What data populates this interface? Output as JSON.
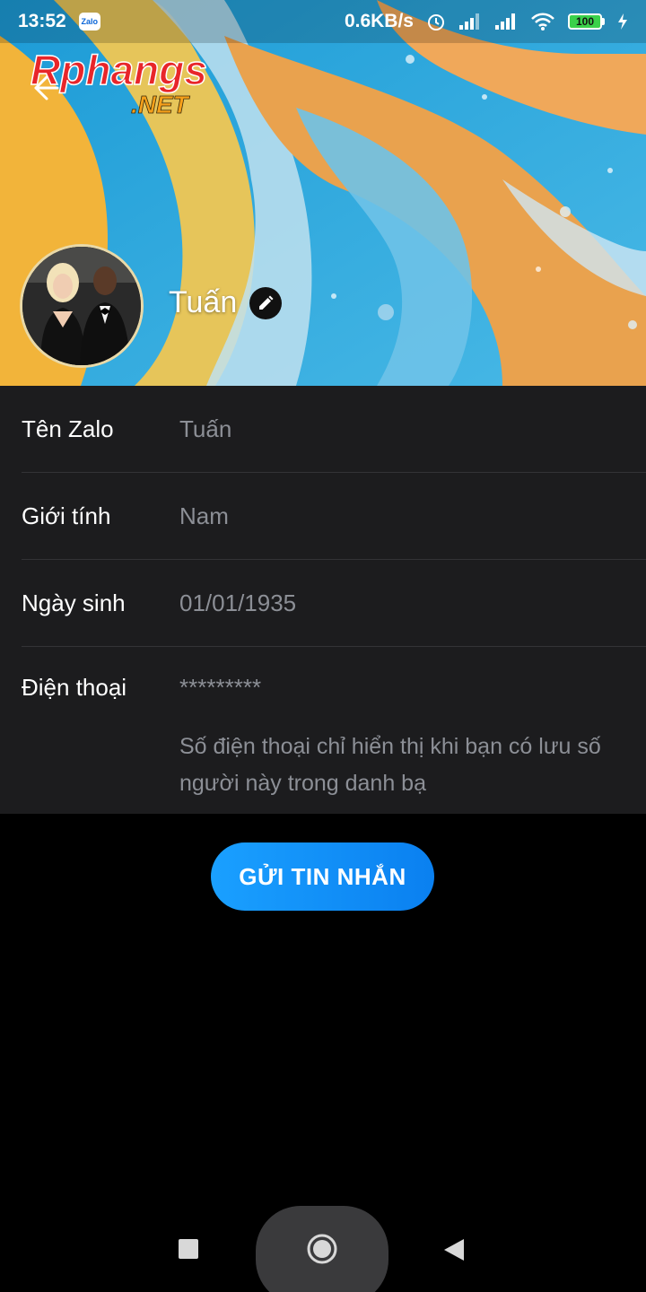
{
  "status_bar": {
    "time": "13:52",
    "app_badge": "Zalo",
    "network_speed": "0.6KB/s",
    "battery_level": "100",
    "icons": [
      "zalo-notification-icon",
      "alarm-icon",
      "signal-icon",
      "signal-icon",
      "wifi-icon",
      "battery-icon",
      "charging-icon"
    ]
  },
  "header": {
    "watermark_main": "Rphangs",
    "watermark_sub": ".NET",
    "back_icon": "back-arrow-icon",
    "profile_name": "Tuấn",
    "edit_icon": "pencil-icon"
  },
  "info_rows": [
    {
      "label": "Tên Zalo",
      "value": "Tuấn"
    },
    {
      "label": "Giới tính",
      "value": "Nam"
    },
    {
      "label": "Ngày sinh",
      "value": "01/01/1935"
    },
    {
      "label": "Điện thoại",
      "value": "*********"
    }
  ],
  "phone_note": "Số điện thoại chỉ hiển thị khi bạn có lưu số người này trong danh bạ",
  "send_button_label": "GỬI TIN NHẮN",
  "colors": {
    "accent": "#0a8cff",
    "panel_bg": "#1c1c1e",
    "label_text": "#ffffff",
    "value_text": "#8c8f96"
  },
  "nav_bar": {
    "icons": [
      "recent-apps-icon",
      "home-icon",
      "back-icon"
    ]
  }
}
